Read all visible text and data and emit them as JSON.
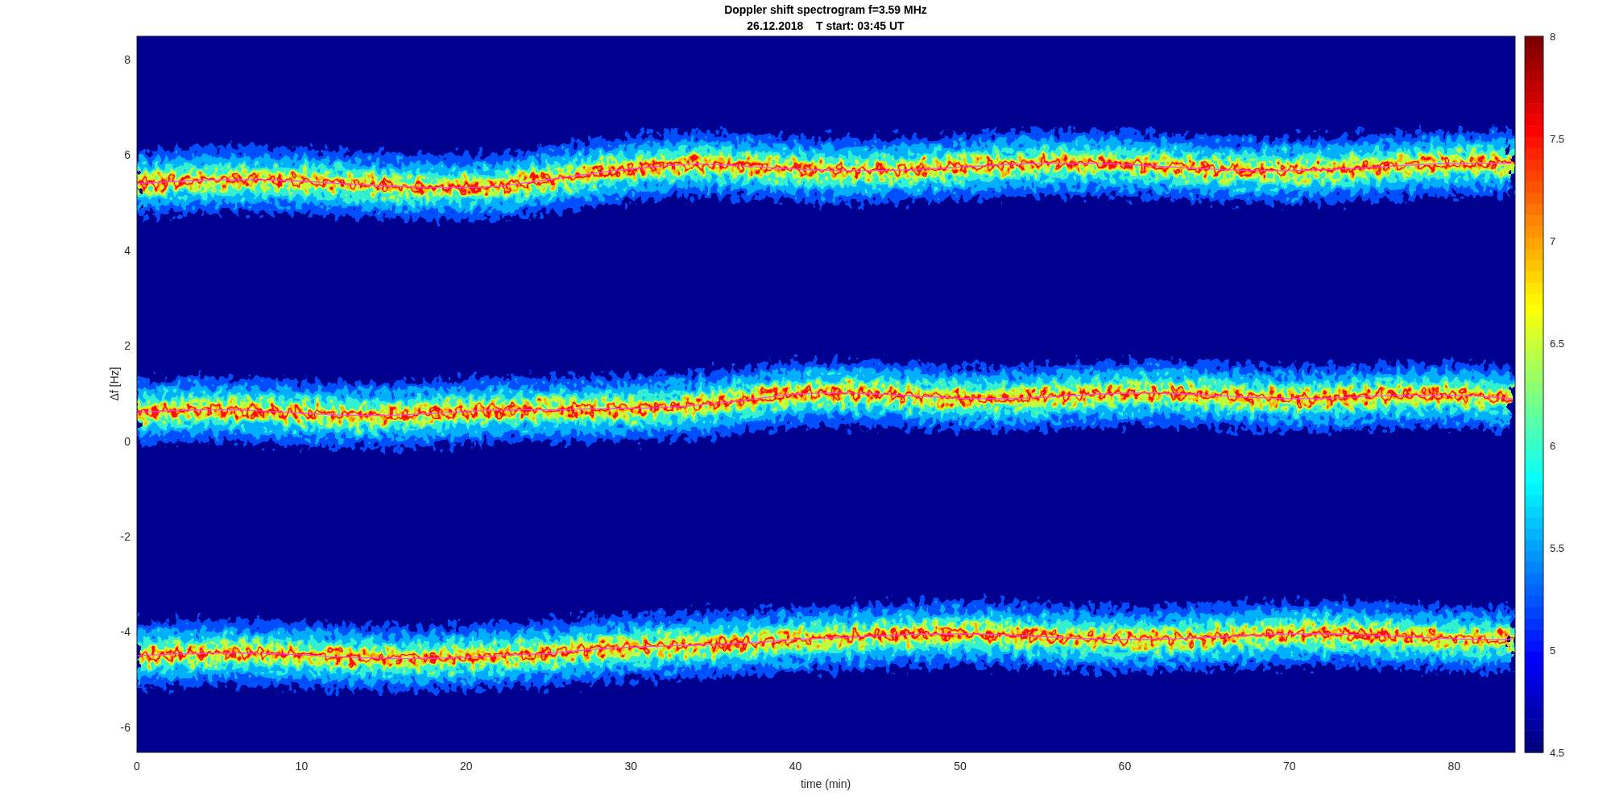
{
  "figure": {
    "title": "Doppler shift spectrogram f=3.59 MHz",
    "subtitle": "26.12.2018    T start: 03:45 UT",
    "xlabel": "time (min)",
    "ylabel": "Δf [Hz]",
    "xticks": [
      "0",
      "10",
      "20",
      "30",
      "40",
      "50",
      "60",
      "70",
      "80"
    ],
    "yticks": [
      "8",
      "6",
      "4",
      "2",
      "0",
      "-2",
      "-4",
      "-6"
    ],
    "colorbar_ticks": [
      "8",
      "7.5",
      "7",
      "6.5",
      "6",
      "5.5",
      "5",
      "4.5"
    ]
  }
}
